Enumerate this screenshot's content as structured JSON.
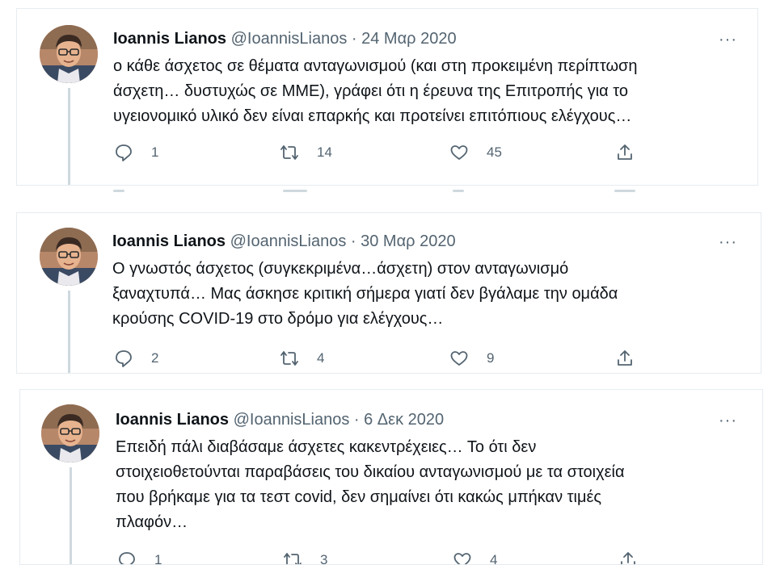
{
  "tweets": [
    {
      "name": "Ioannis Lianos",
      "handle": "@IoannisLianos",
      "separator": "·",
      "date": "24 Μαρ 2020",
      "more": "···",
      "lines": [
        "ο κάθε άσχετος σε θέματα ανταγωνισμού (και στη προκειμένη περίπτωση",
        "άσχετη… δυστυχώς σε ΜΜΕ), γράφει ότι η έρευνα της Επιτροπής για το",
        "υγειονομικό υλικό δεν είναι επαρκής και προτείνει επιτόπιους ελέγχους…"
      ],
      "replies": "1",
      "retweets": "14",
      "likes": "45"
    },
    {
      "name": "Ioannis Lianos",
      "handle": "@IoannisLianos",
      "separator": "·",
      "date": "30 Μαρ 2020",
      "more": "···",
      "lines": [
        "Ο γνωστός άσχετος (συγκεκριμένα…άσχετη) στον ανταγωνισμό",
        "ξαναχτυπά… Μας άσκησε κριτική σήμερα γιατί δεν βγάλαμε την ομάδα",
        "κρούσης COVID-19 στο δρόμο για ελέγχους…"
      ],
      "replies": "2",
      "retweets": "4",
      "likes": "9"
    },
    {
      "name": "Ioannis Lianos",
      "handle": "@IoannisLianos",
      "separator": "·",
      "date": "6 Δεκ 2020",
      "more": "···",
      "lines": [
        "Επειδή πάλι διαβάσαμε άσχετες κακεντρέχειες… Το ότι δεν",
        "στοιχειοθετούνται παραβάσεις του δικαίου ανταγωνισμού με τα στοιχεία",
        "που βρήκαμε για τα τεστ covid, δεν σημαίνει ότι κακώς μπήκαν τιμές",
        "πλαφόν…"
      ],
      "replies": "1",
      "retweets": "3",
      "likes": "4"
    }
  ]
}
